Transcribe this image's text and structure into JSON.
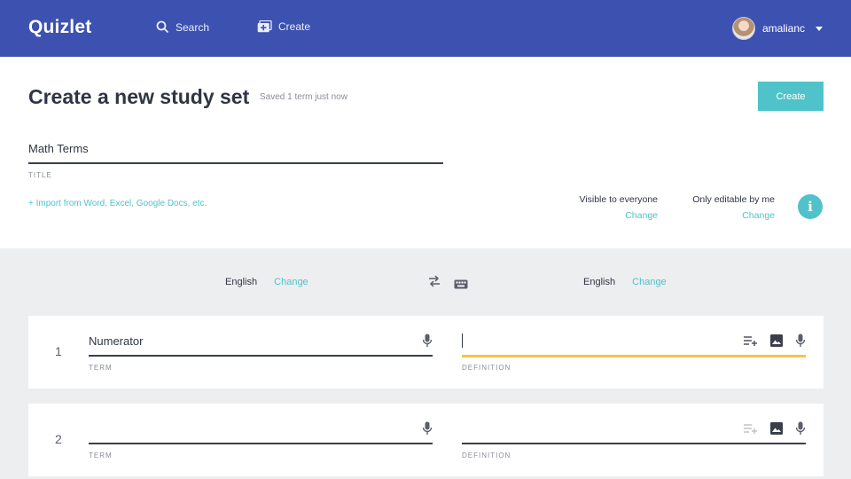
{
  "nav": {
    "logo": "Quizlet",
    "search_label": "Search",
    "create_label": "Create",
    "username": "amalianc"
  },
  "header": {
    "title": "Create a new study set",
    "saved_status": "Saved 1 term just now",
    "create_button": "Create",
    "set_title_value": "Math Terms",
    "set_title_label": "TITLE",
    "import_link": "+ Import from Word, Excel, Google Docs, etc.",
    "visibility": {
      "label": "Visible to everyone",
      "change": "Change"
    },
    "editability": {
      "label": "Only editable by me",
      "change": "Change"
    },
    "info_glyph": "i"
  },
  "languages": {
    "term_language": "English",
    "term_change": "Change",
    "definition_language": "English",
    "definition_change": "Change"
  },
  "cards": [
    {
      "number": "1",
      "term": "Numerator",
      "term_label": "TERM",
      "definition": "",
      "definition_label": "DEFINITION"
    },
    {
      "number": "2",
      "term": "",
      "term_label": "TERM",
      "definition": "",
      "definition_label": "DEFINITION"
    }
  ],
  "colors": {
    "nav_bg": "#3d51b0",
    "accent": "#4fc3c9",
    "active_underline": "#f5c542",
    "page_bg": "#eceef0"
  },
  "icons": [
    "search-icon",
    "create-set-icon",
    "chevron-down-icon",
    "info-icon",
    "swap-icon",
    "keyboard-icon",
    "mic-icon",
    "image-icon",
    "add-list-icon"
  ]
}
